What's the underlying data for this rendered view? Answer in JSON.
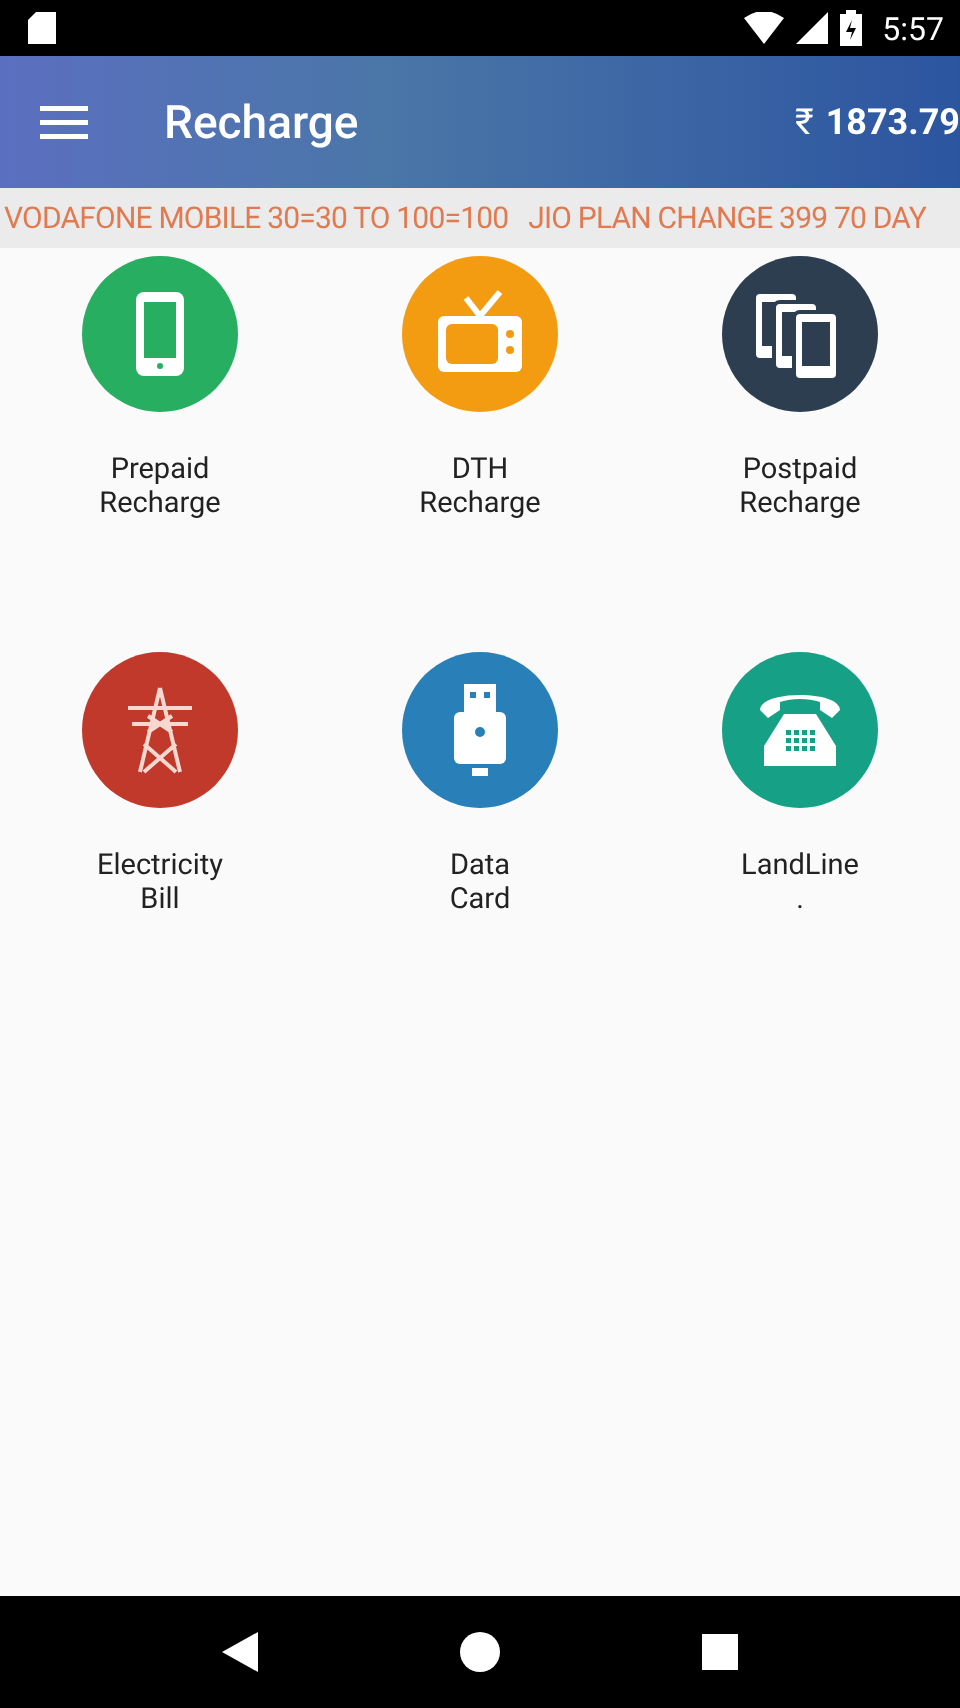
{
  "status_bar": {
    "time": "5:57"
  },
  "app_bar": {
    "title": "Recharge",
    "balance_symbol": "₹",
    "balance": "1873.79"
  },
  "ticker": {
    "text": "VODAFONE MOBILE 30=30 TO 100=100   JIO PLAN CHANGE 399 70 DAY"
  },
  "services": [
    {
      "kind": "phone",
      "color": "#27ae60",
      "label": "Prepaid\nRecharge"
    },
    {
      "kind": "tv",
      "color": "#f39c12",
      "label": "DTH\nRecharge"
    },
    {
      "kind": "phones",
      "color": "#2c3e50",
      "label": "Postpaid\nRecharge"
    },
    {
      "kind": "tower",
      "color": "#c0392b",
      "label": "Electricity\nBill"
    },
    {
      "kind": "usb",
      "color": "#2980b9",
      "label": "Data\nCard"
    },
    {
      "kind": "telephone",
      "color": "#16a085",
      "label": "LandLine\n."
    }
  ]
}
